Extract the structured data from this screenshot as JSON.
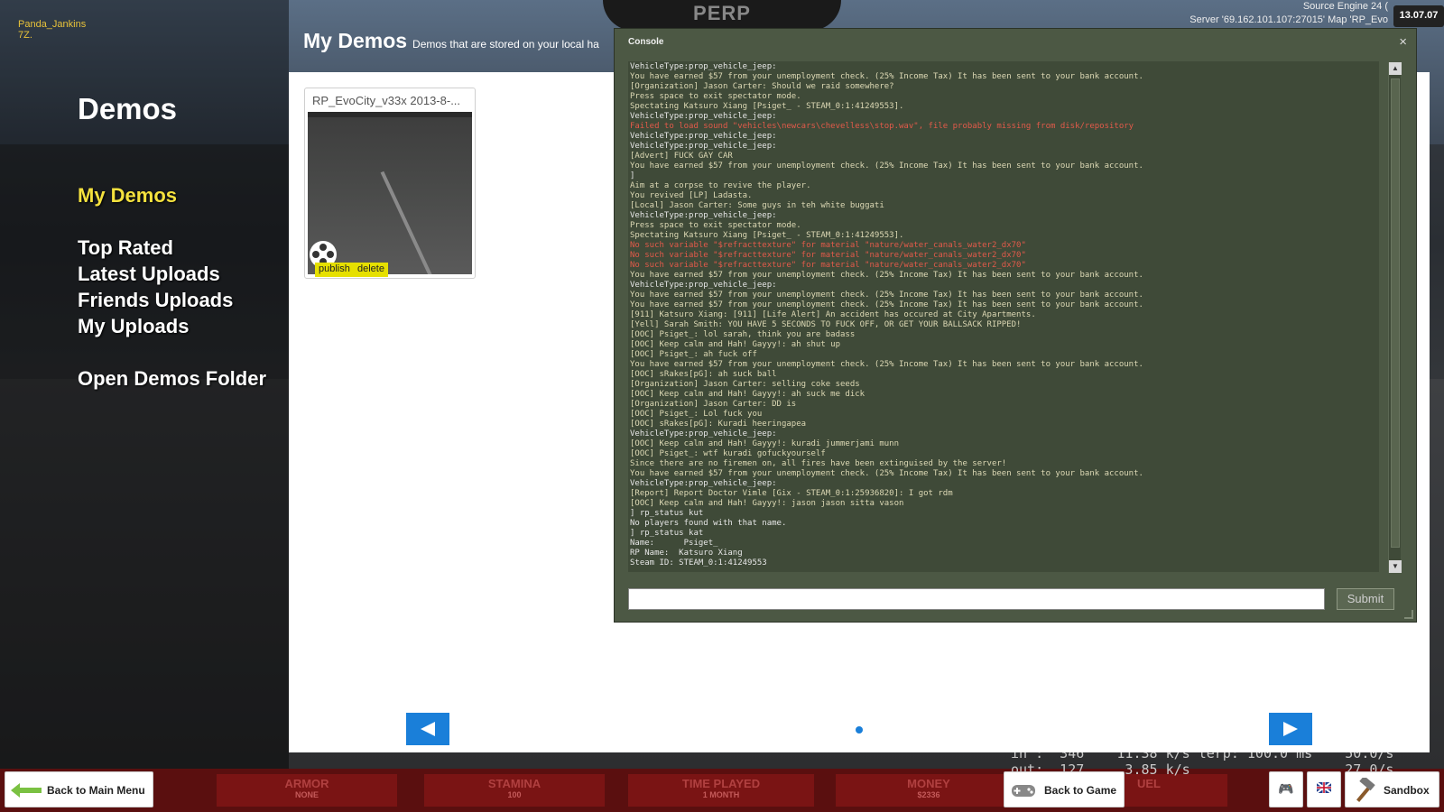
{
  "overlay": {
    "player_name": "Panda_Jankins",
    "player_sub": "7Z.",
    "engine_line": "Source Engine 24 (",
    "server_line": "Server '69.162.101.107:27015' Map 'RP_Evo",
    "date": "13.07.07",
    "game_logo": "PERP"
  },
  "sidebar": {
    "title": "Demos",
    "items": [
      {
        "label": "My Demos",
        "active": true
      },
      {
        "label": "Top Rated"
      },
      {
        "label": "Latest Uploads"
      },
      {
        "label": "Friends Uploads"
      },
      {
        "label": "My Uploads"
      },
      {
        "label": "Open Demos Folder"
      }
    ]
  },
  "main": {
    "title": "My Demos",
    "subtitle": "Demos that are stored on your local ha",
    "demo": {
      "title": "RP_EvoCity_v33x 2013-8-...",
      "publish_label": "publish",
      "delete_label": "delete"
    }
  },
  "console": {
    "title": "Console",
    "close": "×",
    "submit_label": "Submit",
    "input_value": "",
    "lines": [
      {
        "t": "VehicleType:prop_vehicle_jeep:",
        "c": "white"
      },
      {
        "t": "You have earned $57 from your unemployment check. (25% Income Tax) It has been sent to your bank account.",
        "c": "y"
      },
      {
        "t": "[Organization] Jason Carter: Should we raid somewhere?",
        "c": "y"
      },
      {
        "t": "Press space to exit spectator mode.",
        "c": "y"
      },
      {
        "t": "Spectating Katsuro Xiang [Psiget_ - STEAM_0:1:41249553].",
        "c": "y"
      },
      {
        "t": "VehicleType:prop_vehicle_jeep:",
        "c": "white"
      },
      {
        "t": "Failed to load sound \"vehicles\\newcars\\chevelless\\stop.wav\", file probably missing from disk/repository",
        "c": "red"
      },
      {
        "t": "VehicleType:prop_vehicle_jeep:",
        "c": "white"
      },
      {
        "t": "VehicleType:prop_vehicle_jeep:",
        "c": "white"
      },
      {
        "t": "[Advert] FUCK GAY CAR",
        "c": "y"
      },
      {
        "t": "You have earned $57 from your unemployment check. (25% Income Tax) It has been sent to your bank account.",
        "c": "y"
      },
      {
        "t": "]",
        "c": "white"
      },
      {
        "t": "Aim at a corpse to revive the player.",
        "c": "y"
      },
      {
        "t": "You revived [LP] Ladasta.",
        "c": "y"
      },
      {
        "t": "[Local] Jason Carter: Some guys in teh white buggati",
        "c": "y"
      },
      {
        "t": "VehicleType:prop_vehicle_jeep:",
        "c": "white"
      },
      {
        "t": "Press space to exit spectator mode.",
        "c": "y"
      },
      {
        "t": "Spectating Katsuro Xiang [Psiget_ - STEAM_0:1:41249553].",
        "c": "y"
      },
      {
        "t": "No such variable \"$refracttexture\" for material \"nature/water_canals_water2_dx70\"",
        "c": "red"
      },
      {
        "t": "No such variable \"$refracttexture\" for material \"nature/water_canals_water2_dx70\"",
        "c": "red"
      },
      {
        "t": "No such variable \"$refracttexture\" for material \"nature/water_canals_water2_dx70\"",
        "c": "red"
      },
      {
        "t": "You have earned $57 from your unemployment check. (25% Income Tax) It has been sent to your bank account.",
        "c": "y"
      },
      {
        "t": "VehicleType:prop_vehicle_jeep:",
        "c": "white"
      },
      {
        "t": "You have earned $57 from your unemployment check. (25% Income Tax) It has been sent to your bank account.",
        "c": "y"
      },
      {
        "t": "You have earned $57 from your unemployment check. (25% Income Tax) It has been sent to your bank account.",
        "c": "y"
      },
      {
        "t": "[911] Katsuro Xiang: [911] [Life Alert] An accident has occured at City Apartments.",
        "c": "y"
      },
      {
        "t": "[Yell] Sarah Smith: YOU HAVE 5 SECONDS TO FUCK OFF, OR GET YOUR BALLSACK RIPPED!",
        "c": "y"
      },
      {
        "t": "[OOC] Psiget_: lol sarah, think you are badass",
        "c": "y"
      },
      {
        "t": "[OOC] Keep calm and Hah! Gayyy!: ah shut up",
        "c": "y"
      },
      {
        "t": "[OOC] Psiget_: ah fuck off",
        "c": "y"
      },
      {
        "t": "You have earned $57 from your unemployment check. (25% Income Tax) It has been sent to your bank account.",
        "c": "y"
      },
      {
        "t": "[OOC] sRakes[pG]: ah suck ball",
        "c": "y"
      },
      {
        "t": "[Organization] Jason Carter: selling coke seeds",
        "c": "y"
      },
      {
        "t": "[OOC] Keep calm and Hah! Gayyy!: ah suck me dick",
        "c": "y"
      },
      {
        "t": "[Organization] Jason Carter: DD is",
        "c": "y"
      },
      {
        "t": "[OOC] Psiget_: Lol fuck you",
        "c": "y"
      },
      {
        "t": "[OOC] sRakes[pG]: Kuradi heeringapea",
        "c": "y"
      },
      {
        "t": "VehicleType:prop_vehicle_jeep:",
        "c": "white"
      },
      {
        "t": "[OOC] Keep calm and Hah! Gayyy!: kuradi jummerjami munn",
        "c": "y"
      },
      {
        "t": "[OOC] Psiget_: wtf kuradi gofuckyourself",
        "c": "y"
      },
      {
        "t": "Since there are no firemen on, all fires have been extinguised by the server!",
        "c": "y"
      },
      {
        "t": "You have earned $57 from your unemployment check. (25% Income Tax) It has been sent to your bank account.",
        "c": "y"
      },
      {
        "t": "VehicleType:prop_vehicle_jeep:",
        "c": "white"
      },
      {
        "t": "[Report] Report Doctor Vimle [Gix - STEAM_0:1:25936820]: I got rdm",
        "c": "y"
      },
      {
        "t": "[OOC] Keep calm and Hah! Gayyy!: jason jason sitta vason",
        "c": "y"
      },
      {
        "t": "] rp_status kut",
        "c": "white"
      },
      {
        "t": "No players found with that name.",
        "c": "white"
      },
      {
        "t": "] rp_status kat",
        "c": "white"
      },
      {
        "t": "Name:      Psiget_",
        "c": "white"
      },
      {
        "t": "RP Name:  Katsuro Xiang",
        "c": "white"
      },
      {
        "t": "Steam ID: STEAM_0:1:41249553",
        "c": "white"
      }
    ]
  },
  "hud": [
    {
      "label": "ARMOR",
      "value": "NONE"
    },
    {
      "label": "STAMINA",
      "value": "100"
    },
    {
      "label": "TIME PLAYED",
      "value": "1 MONTH"
    },
    {
      "label": "MONEY",
      "value": "$2336"
    },
    {
      "label": "UEL",
      "value": ""
    }
  ],
  "netgraph": {
    "line1": "in :  346    11.38 k/s lerp: 100.0 ms    50.0/s",
    "line2": "out:  127     3.85 k/s                   27.0/s"
  },
  "bottom": {
    "back_to_main": "Back to Main Menu",
    "back_to_game": "Back to Game",
    "sandbox": "Sandbox"
  },
  "colors": {
    "accent_blue": "#1a7fd9",
    "active_menu": "#f4e13e",
    "console_bg": "#4c5844"
  }
}
